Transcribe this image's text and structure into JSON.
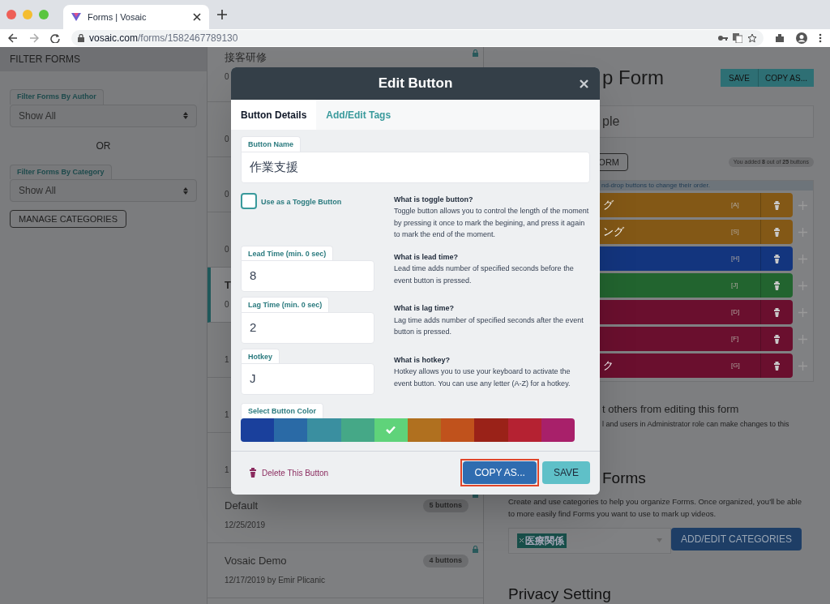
{
  "browser": {
    "tab_title": "Forms | Vosaic",
    "url_host": "vosaic.com",
    "url_path": "/forms/1582467789130"
  },
  "sidebar": {
    "header": "FILTER FORMS",
    "filters": [
      {
        "label": "Filter Forms By Author",
        "value": "Show All"
      },
      {
        "label": "Filter Forms By Category",
        "value": "Show All"
      }
    ],
    "or_label": "OR",
    "manage_button": "MANAGE CATEGORIES"
  },
  "form_list": [
    {
      "title": "接客研修",
      "date": "0",
      "locked": true,
      "selected": false
    },
    {
      "date": "0",
      "selected": false
    },
    {
      "date": "0",
      "selected": false
    },
    {
      "date": "0",
      "selected": false
    },
    {
      "title": "T",
      "date": "0",
      "selected": true
    },
    {
      "date": "1",
      "selected": false
    },
    {
      "date": "1",
      "selected": false
    },
    {
      "date": "1",
      "selected": false
    },
    {
      "title": "Default",
      "date": "12/25/2019",
      "badge": "5 buttons",
      "locked": true,
      "selected": false
    },
    {
      "title": "Vosaic Demo",
      "date": "12/17/2019 by Emir Plicanic",
      "badge": "4 buttons",
      "locked": true,
      "selected": false
    }
  ],
  "main": {
    "title": "p Form",
    "save_button": "SAVE",
    "copy_button": "COPY AS...",
    "name_value": "ple",
    "form_button": "ORM",
    "count_text": "You added **8** out of **25** buttons",
    "hint": "nd-drop buttons to change their order.",
    "buttons": [
      {
        "label": "グ",
        "hotkey": "[A]",
        "color": "#835816"
      },
      {
        "label": "ング",
        "hotkey": "[S]",
        "color": "#835816"
      },
      {
        "hotkey": "[H]",
        "color": "#13357e"
      },
      {
        "hotkey": "[J]",
        "color": "#22642f"
      },
      {
        "hotkey": "[D]",
        "color": "#6a0f2e"
      },
      {
        "hotkey": "[F]",
        "color": "#6a0f2e"
      },
      {
        "label": "ク",
        "hotkey": "[G]",
        "color": "#6a0f2e"
      }
    ],
    "lock_title": "t others from editing this form",
    "lock_text": "l and users in Administrator role can make changes to this",
    "categories_heading": "Forms",
    "categories_text": "Create and use categories to help you organize Forms. Once organized, you'll be able to more easily find Forms you want to use to mark up videos.",
    "tag": "医療関係",
    "add_categories_button": "ADD/EDIT CATEGORIES",
    "privacy_heading": "Privacy Setting"
  },
  "modal": {
    "title": "Edit Button",
    "tabs": [
      {
        "label": "Button Details",
        "selected": true
      },
      {
        "label": "Add/Edit Tags",
        "selected": false
      }
    ],
    "button_name": {
      "label": "Button Name",
      "value": "作業支援"
    },
    "toggle": {
      "label": "Use as a Toggle Button",
      "checked": false
    },
    "help": [
      {
        "title": "What is toggle button?",
        "text": "Toggle button allows you to control the length of the moment by pressing it once to mark the begining, and press it again to mark the end of the moment."
      },
      {
        "title": "What is lead time?",
        "text": "Lead time adds number of specified seconds before the event button is pressed."
      },
      {
        "title": "What is lag time?",
        "text": "Lag time adds number of specified seconds after the event button is pressed."
      },
      {
        "title": "What is hotkey?",
        "text": "Hotkey allows you to use your keyboard to activate the event button. You can use any letter (A-Z) for a hotkey."
      }
    ],
    "fields": [
      {
        "label": "Lead Time (min. 0 sec)",
        "value": "8"
      },
      {
        "label": "Lag Time (min. 0 sec)",
        "value": "2"
      },
      {
        "label": "Hotkey",
        "value": "J"
      }
    ],
    "color_label": "Select Button Color",
    "colors": [
      {
        "color": "#1a409c",
        "selected": false
      },
      {
        "color": "#2a6aa6",
        "selected": false
      },
      {
        "color": "#3a8fa0",
        "selected": false
      },
      {
        "color": "#45a887",
        "selected": false
      },
      {
        "color": "#5fd37a",
        "selected": true
      },
      {
        "color": "#b0701f",
        "selected": false
      },
      {
        "color": "#c0521c",
        "selected": false
      },
      {
        "color": "#9a2218",
        "selected": false
      },
      {
        "color": "#b52232",
        "selected": false
      },
      {
        "color": "#a8206a",
        "selected": false
      }
    ],
    "delete_label": "Delete This Button",
    "copy_button": "COPY AS...",
    "save_button": "SAVE"
  }
}
